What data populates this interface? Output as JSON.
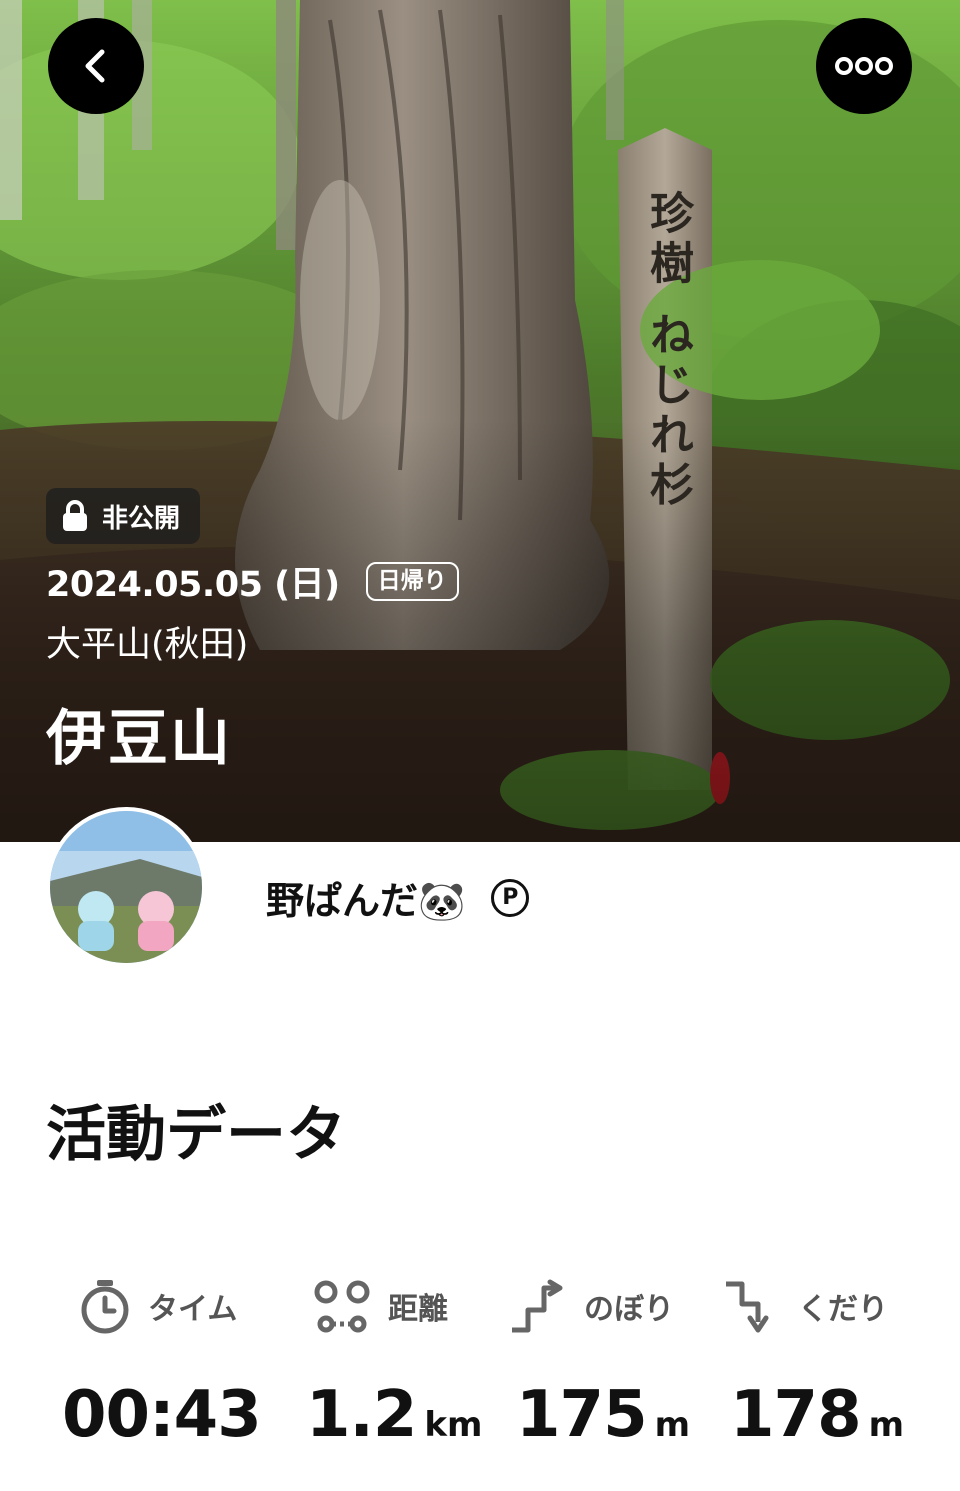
{
  "hero": {
    "privacy_label": "非公開",
    "date": "2024.05.05 (日)",
    "trip_type": "日帰り",
    "area": "大平山(秋田)",
    "peak": "伊豆山",
    "signpost_text": "珍樹 ねじれ杉"
  },
  "icons": {
    "back": "chevron-left-icon",
    "more": "ellipsis-icon",
    "lock": "lock-icon"
  },
  "user": {
    "name": "野ぱんだ🐼",
    "premium_mark": "P"
  },
  "activity": {
    "title": "活動データ",
    "stats": [
      {
        "label": "タイム",
        "value": "00:43",
        "unit": ""
      },
      {
        "label": "距離",
        "value": "1.2",
        "unit": "km"
      },
      {
        "label": "のぼり",
        "value": "175",
        "unit": "m"
      },
      {
        "label": "くだり",
        "value": "178",
        "unit": "m"
      }
    ]
  },
  "colors": {
    "button_bg": "#000000",
    "text": "#111111",
    "label": "#555555"
  }
}
